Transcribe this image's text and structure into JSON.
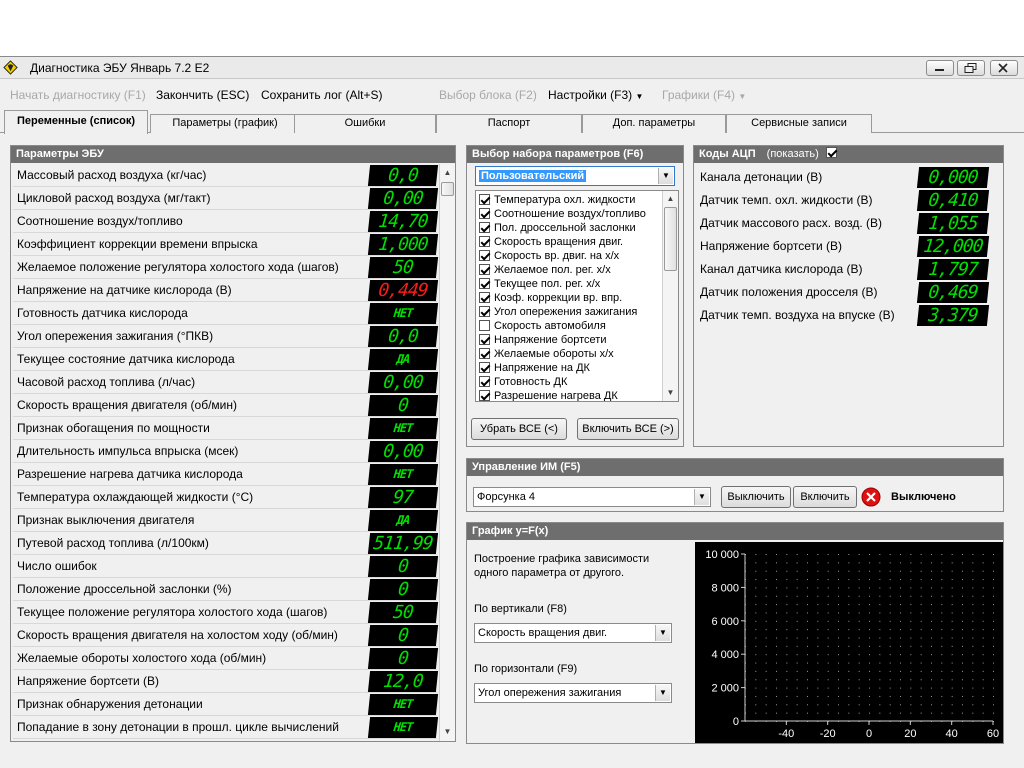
{
  "window": {
    "title": "Диагностика ЭБУ Январь 7.2 E2"
  },
  "menu": {
    "start": "Начать диагностику (F1)",
    "finish": "Закончить (ESC)",
    "save_log": "Сохранить лог (Alt+S)",
    "select_block": "Выбор блока (F2)",
    "settings": "Настройки (F3)",
    "graphs": "Графики (F4)"
  },
  "tabs": [
    "Переменные (список)",
    "Параметры (график)",
    "Ошибки",
    "Паспорт",
    "Доп. параметры",
    "Сервисные записи"
  ],
  "params_panel": {
    "title": "Параметры ЭБУ",
    "rows": [
      {
        "label": "Массовый расход воздуха (кг/час)",
        "value": "0,0"
      },
      {
        "label": "Цикловой расход воздуха (мг/такт)",
        "value": "0,00"
      },
      {
        "label": "Соотношение воздух/топливо",
        "value": "14,70"
      },
      {
        "label": "Коэффициент коррекции времени впрыска",
        "value": "1,000"
      },
      {
        "label": "Желаемое положение регулятора холостого хода (шагов)",
        "value": "50"
      },
      {
        "label": "Напряжение на датчике кислорода (В)",
        "value": "0,449",
        "color": "#ff1a1a"
      },
      {
        "label": "Готовность датчика кислорода",
        "value": "НЕТ"
      },
      {
        "label": "Угол опережения зажигания (°ПКВ)",
        "value": "0,0"
      },
      {
        "label": "Текущее состояние датчика кислорода",
        "value": "ДА"
      },
      {
        "label": "Часовой расход топлива (л/час)",
        "value": "0,00"
      },
      {
        "label": "Скорость вращения двигателя (об/мин)",
        "value": "0"
      },
      {
        "label": "Признак обогащения по мощности",
        "value": "НЕТ"
      },
      {
        "label": "Длительность импульса впрыска (мсек)",
        "value": "0,00"
      },
      {
        "label": "Разрешение нагрева датчика кислорода",
        "value": "НЕТ"
      },
      {
        "label": "Температура охлаждающей жидкости (°C)",
        "value": "97"
      },
      {
        "label": "Признак выключения двигателя",
        "value": "ДА"
      },
      {
        "label": "Путевой расход топлива (л/100км)",
        "value": "511,99"
      },
      {
        "label": "Число ошибок",
        "value": "0"
      },
      {
        "label": "Положение дроссельной заслонки (%)",
        "value": "0"
      },
      {
        "label": "Текущее положение регулятора холостого хода (шагов)",
        "value": "50"
      },
      {
        "label": "Скорость вращения двигателя на холостом ходу (об/мин)",
        "value": "0"
      },
      {
        "label": "Желаемые обороты холостого хода (об/мин)",
        "value": "0"
      },
      {
        "label": "Напряжение бортсети (В)",
        "value": "12,0"
      },
      {
        "label": "Признак обнаружения детонации",
        "value": "НЕТ"
      },
      {
        "label": "Попадание в зону детонации в прошл. цикле вычислений",
        "value": "НЕТ"
      }
    ]
  },
  "paramset_panel": {
    "title": "Выбор набора параметров (F6)",
    "selected": "Пользовательский",
    "items": [
      {
        "label": "Температура охл. жидкости",
        "checked": true
      },
      {
        "label": "Соотношение воздух/топливо",
        "checked": true
      },
      {
        "label": "Пол. дроссельной заслонки",
        "checked": true
      },
      {
        "label": "Скорость вращения двиг.",
        "checked": true
      },
      {
        "label": "Скорость вр. двиг. на х/х",
        "checked": true
      },
      {
        "label": "Желаемое пол. рег. х/х",
        "checked": true
      },
      {
        "label": "Текущее пол. рег. х/х",
        "checked": true
      },
      {
        "label": "Коэф. коррекции вр. впр.",
        "checked": true
      },
      {
        "label": "Угол опережения зажигания",
        "checked": true
      },
      {
        "label": "Скорость автомобиля",
        "checked": false
      },
      {
        "label": "Напряжение бортсети",
        "checked": true
      },
      {
        "label": "Желаемые обороты х/х",
        "checked": true
      },
      {
        "label": "Напряжение на ДК",
        "checked": true
      },
      {
        "label": "Готовность ДК",
        "checked": true
      },
      {
        "label": "Разрешение нагрева ДК",
        "checked": true
      }
    ],
    "remove_all": "Убрать ВСЕ (<)",
    "include_all": "Включить ВСЕ (>)"
  },
  "adc_panel": {
    "title": "Коды АЦП",
    "show_label": "(показать)",
    "show_checked": true,
    "rows": [
      {
        "label": "Канала детонации (В)",
        "value": "0,000"
      },
      {
        "label": "Датчик темп. охл. жидкости (В)",
        "value": "0,410"
      },
      {
        "label": "Датчик массового расх. возд. (В)",
        "value": "1,055"
      },
      {
        "label": "Напряжение бортсети (В)",
        "value": "12,000"
      },
      {
        "label": "Канал датчика кислорода (В)",
        "value": "1,797"
      },
      {
        "label": "Датчик положения дросселя (В)",
        "value": "0,469"
      },
      {
        "label": "Датчик темп. воздуха на впуске (В)",
        "value": "3,379"
      }
    ]
  },
  "actuator_panel": {
    "title": "Управление ИМ (F5)",
    "selected": "Форсунка 4",
    "off_button": "Выключить",
    "on_button": "Включить",
    "status": "Выключено"
  },
  "graph_panel": {
    "title": "График y=F(x)",
    "description_line1": "Построение графика зависимости",
    "description_line2": "одного параметра от другого.",
    "vertical_label": "По вертикали (F8)",
    "vertical_selected": "Скорость вращения двиг.",
    "horizontal_label": "По горизонтали (F9)",
    "horizontal_selected": "Угол опережения зажигания"
  },
  "chart_data": {
    "type": "scatter",
    "series": [],
    "xlim": [
      -60,
      60
    ],
    "ylim": [
      0,
      10000
    ],
    "x_ticks": [
      "-40",
      "-20",
      "0",
      "20",
      "40",
      "60"
    ],
    "y_ticks": [
      "10 000",
      "8 000",
      "6 000",
      "4 000",
      "2 000",
      "0"
    ],
    "grid": true,
    "background": "#000000"
  },
  "colors": {
    "lcd_green": "#00e000",
    "lcd_red": "#ff1a1a",
    "panel_header": "#6e6e6e"
  }
}
